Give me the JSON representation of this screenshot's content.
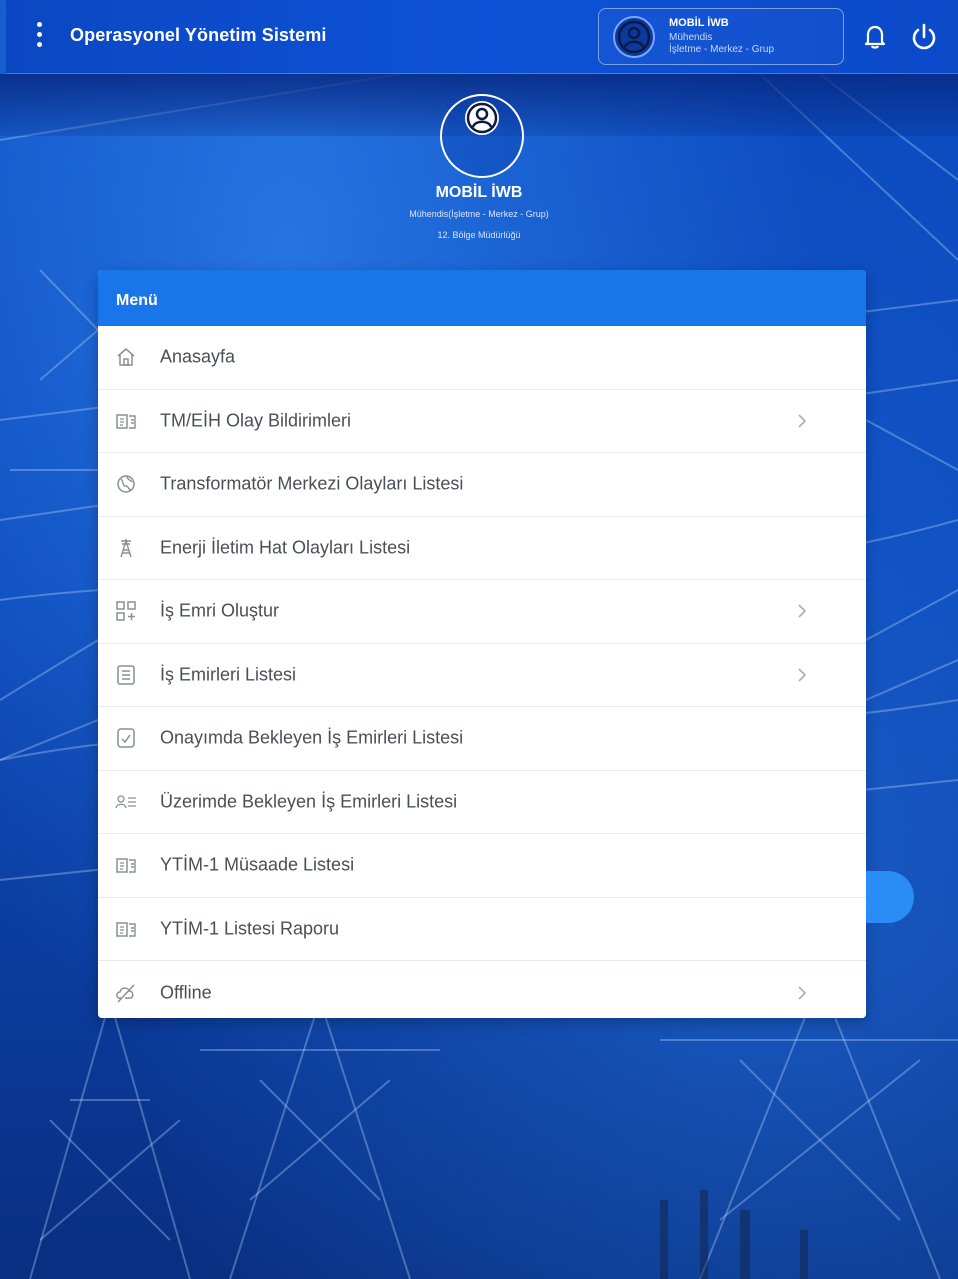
{
  "header": {
    "title": "Operasyonel Yönetim Sistemi",
    "user": {
      "name": "MOBİL İWB",
      "role": "Mühendis",
      "department": "İşletme - Merkez - Grup"
    },
    "icons": {
      "menu": "kebab-menu-icon",
      "avatar": "user-circle-icon",
      "notifications": "bell-icon",
      "logout": "power-icon"
    }
  },
  "profile": {
    "name": "MOBİL İWB",
    "role_line": "Mühendis(İşletme - Merkez - Grup)",
    "region": "12. Bölge Müdürlüğü"
  },
  "menu": {
    "title": "Menü",
    "items": [
      {
        "label": "Anasayfa",
        "icon": "home-icon",
        "has_submenu": false
      },
      {
        "label": "TM/EİH Olay Bildirimleri",
        "icon": "report-icon",
        "has_submenu": true
      },
      {
        "label": "Transformatör Merkezi Olayları Listesi",
        "icon": "globe-icon",
        "has_submenu": false
      },
      {
        "label": "Enerji İletim Hat Olayları Listesi",
        "icon": "tower-icon",
        "has_submenu": false
      },
      {
        "label": "İş Emri Oluştur",
        "icon": "grid-add-icon",
        "has_submenu": true
      },
      {
        "label": "İş Emirleri Listesi",
        "icon": "list-icon",
        "has_submenu": true
      },
      {
        "label": "Onayımda Bekleyen İş Emirleri Listesi",
        "icon": "approval-icon",
        "has_submenu": false
      },
      {
        "label": "Üzerimde Bekleyen İş Emirleri Listesi",
        "icon": "user-list-icon",
        "has_submenu": false
      },
      {
        "label": "YTİM-1 Müsaade Listesi",
        "icon": "report-icon",
        "has_submenu": false
      },
      {
        "label": "YTİM-1 Listesi Raporu",
        "icon": "report-icon",
        "has_submenu": false
      },
      {
        "label": "Offline",
        "icon": "offline-icon",
        "has_submenu": true
      }
    ]
  },
  "colors": {
    "header_bg": "#0d52d6",
    "menu_header_bg": "#1976ea",
    "text": "#4a4f57",
    "icon": "#8a8f96"
  }
}
